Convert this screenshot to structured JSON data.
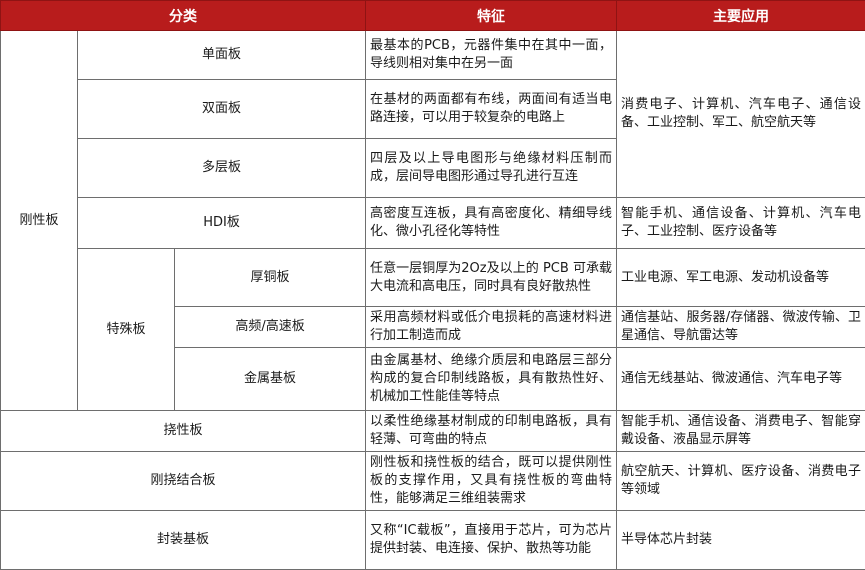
{
  "table": {
    "headers": {
      "category": "分类",
      "features": "特征",
      "applications": "主要应用"
    },
    "rigid_label": "刚性板",
    "special_label": "特殊板",
    "rows": {
      "single": {
        "name": "单面板",
        "features": "最基本的PCB，元器件集中在其中一面，导线则相对集中在另一面"
      },
      "double": {
        "name": "双面板",
        "features": "在基材的两面都有布线，两面间有适当电路连接，可以用于较复杂的电路上"
      },
      "multilayer": {
        "name": "多层板",
        "features": "四层及以上导电图形与绝缘材料压制而成，层间导电图形通过导孔进行互连"
      },
      "group_apps": "消费电子、计算机、汽车电子、通信设备、工业控制、军工、航空航天等",
      "hdi": {
        "name": "HDI板",
        "features": "高密度互连板，具有高密度化、精细导线化、微小孔径化等特性",
        "apps": "智能手机、通信设备、计算机、汽车电子、工业控制、医疗设备等"
      },
      "thick_copper": {
        "name": "厚铜板",
        "features": "任意一层铜厚为2Oz及以上的 PCB 可承载大电流和高电压，同时具有良好散热性",
        "apps": "工业电源、军工电源、发动机设备等"
      },
      "high_freq": {
        "name": "高频/高速板",
        "features": "采用高频材料或低介电损耗的高速材料进行加工制造而成",
        "apps": "通信基站、服务器/存储器、微波传输、卫星通信、导航雷达等"
      },
      "metal_base": {
        "name": "金属基板",
        "features": "由金属基材、绝缘介质层和电路层三部分构成的复合印制线路板，具有散热性好、机械加工性能佳等特点",
        "apps": "通信无线基站、微波通信、汽车电子等"
      },
      "flexible": {
        "name": "挠性板",
        "features": "以柔性绝缘基材制成的印制电路板，具有轻薄、可弯曲的特点",
        "apps": "智能手机、通信设备、消费电子、智能穿戴设备、液晶显示屏等"
      },
      "rigid_flex": {
        "name": "刚挠结合板",
        "features": "刚性板和挠性板的结合，既可以提供刚性板的支撑作用，又具有挠性板的弯曲特性，能够满足三维组装需求",
        "apps": "航空航天、计算机、医疗设备、消费电子等领域"
      },
      "substrate": {
        "name": "封装基板",
        "features": "又称“IC载板”，直接用于芯片，可为芯片提供封装、电连接、保护、散热等功能",
        "apps": "半导体芯片封装"
      }
    }
  }
}
